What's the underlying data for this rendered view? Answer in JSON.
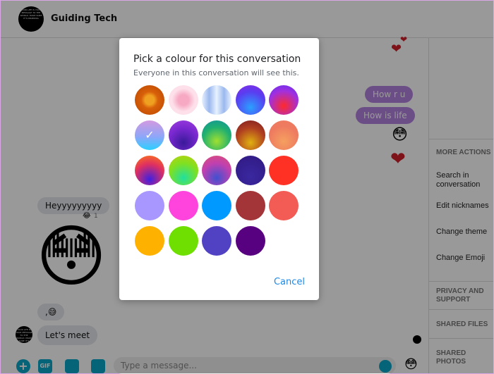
{
  "header": {
    "title": "Guiding Tech",
    "avatar_text": "YOUR LIFE IS YOUR MESSAGE TO THE WORLD. MAKE SURE IT'S INSPIRING"
  },
  "messages": {
    "out": [
      "How r u",
      "How is life"
    ],
    "in": [
      "Heyyyyyyyyy",
      "Let's meet"
    ],
    "reaction_count": "1",
    "comma_emoji": ","
  },
  "composer": {
    "placeholder": "Type a message...",
    "gif_label": "GIF"
  },
  "sidebar": {
    "more_actions": "MORE ACTIONS",
    "items": [
      "Search in conversation",
      "Edit nicknames",
      "Change theme",
      "Change Emoji"
    ],
    "privacy": "PRIVACY AND SUPPORT",
    "shared_files": "SHARED FILES",
    "shared_photos": "SHARED PHOTOS"
  },
  "modal": {
    "title": "Pick a colour for this conversation",
    "subtitle": "Everyone in this conversation will see this.",
    "cancel": "Cancel",
    "selected_index": 5,
    "swatches": [
      "radial-gradient(circle at 50% 50%,#f0a020 0 22%,#d8600a 40%,#b84500)",
      "radial-gradient(circle,#f7a9c4 0 25%,#fde0ea 55%)",
      "linear-gradient(90deg,#e8f2ff,#9bb8ee,#e8f2ff,#9bb8ee,#e8f2ff)",
      "radial-gradient(circle at 50% 75%,#2aa0ff,#5a3cf0 60%,#8a2be2)",
      "radial-gradient(circle at 50% 70%,#ff2a2a,#a030e0 60%,#5a30f0)",
      "linear-gradient(180deg,#d29ae0,#8ea6f8 55%,#2bd0ff)",
      "radial-gradient(circle at 50% 75%,#3a1a9a,#7a28d0 55%,#a040e0)",
      "radial-gradient(circle at 50% 70%,#a0e030,#20b070 55%,#1090a0)",
      "radial-gradient(circle at 50% 75%,#e0b010,#b04020 55%,#7a1a20)",
      "radial-gradient(circle at 50% 70%,#f5a060,#ee7a60 60%)",
      "radial-gradient(circle at 50% 80%,#4020e0,#e03060 55%,#ff8010)",
      "radial-gradient(circle at 50% 75%,#20e0a0,#80e020 55%,#c0d010)",
      "radial-gradient(circle at 50% 75%,#4050d0,#c040b0 55%,#e05070)",
      "radial-gradient(circle at 50% 70%,#3a28a0,#301880)",
      "#ff3124",
      "#a797ff",
      "#ff44dd",
      "#0099ff",
      "#a33437",
      "#f25c54",
      "#ffb100",
      "#6edf00",
      "#5141c3",
      "#570080"
    ]
  }
}
